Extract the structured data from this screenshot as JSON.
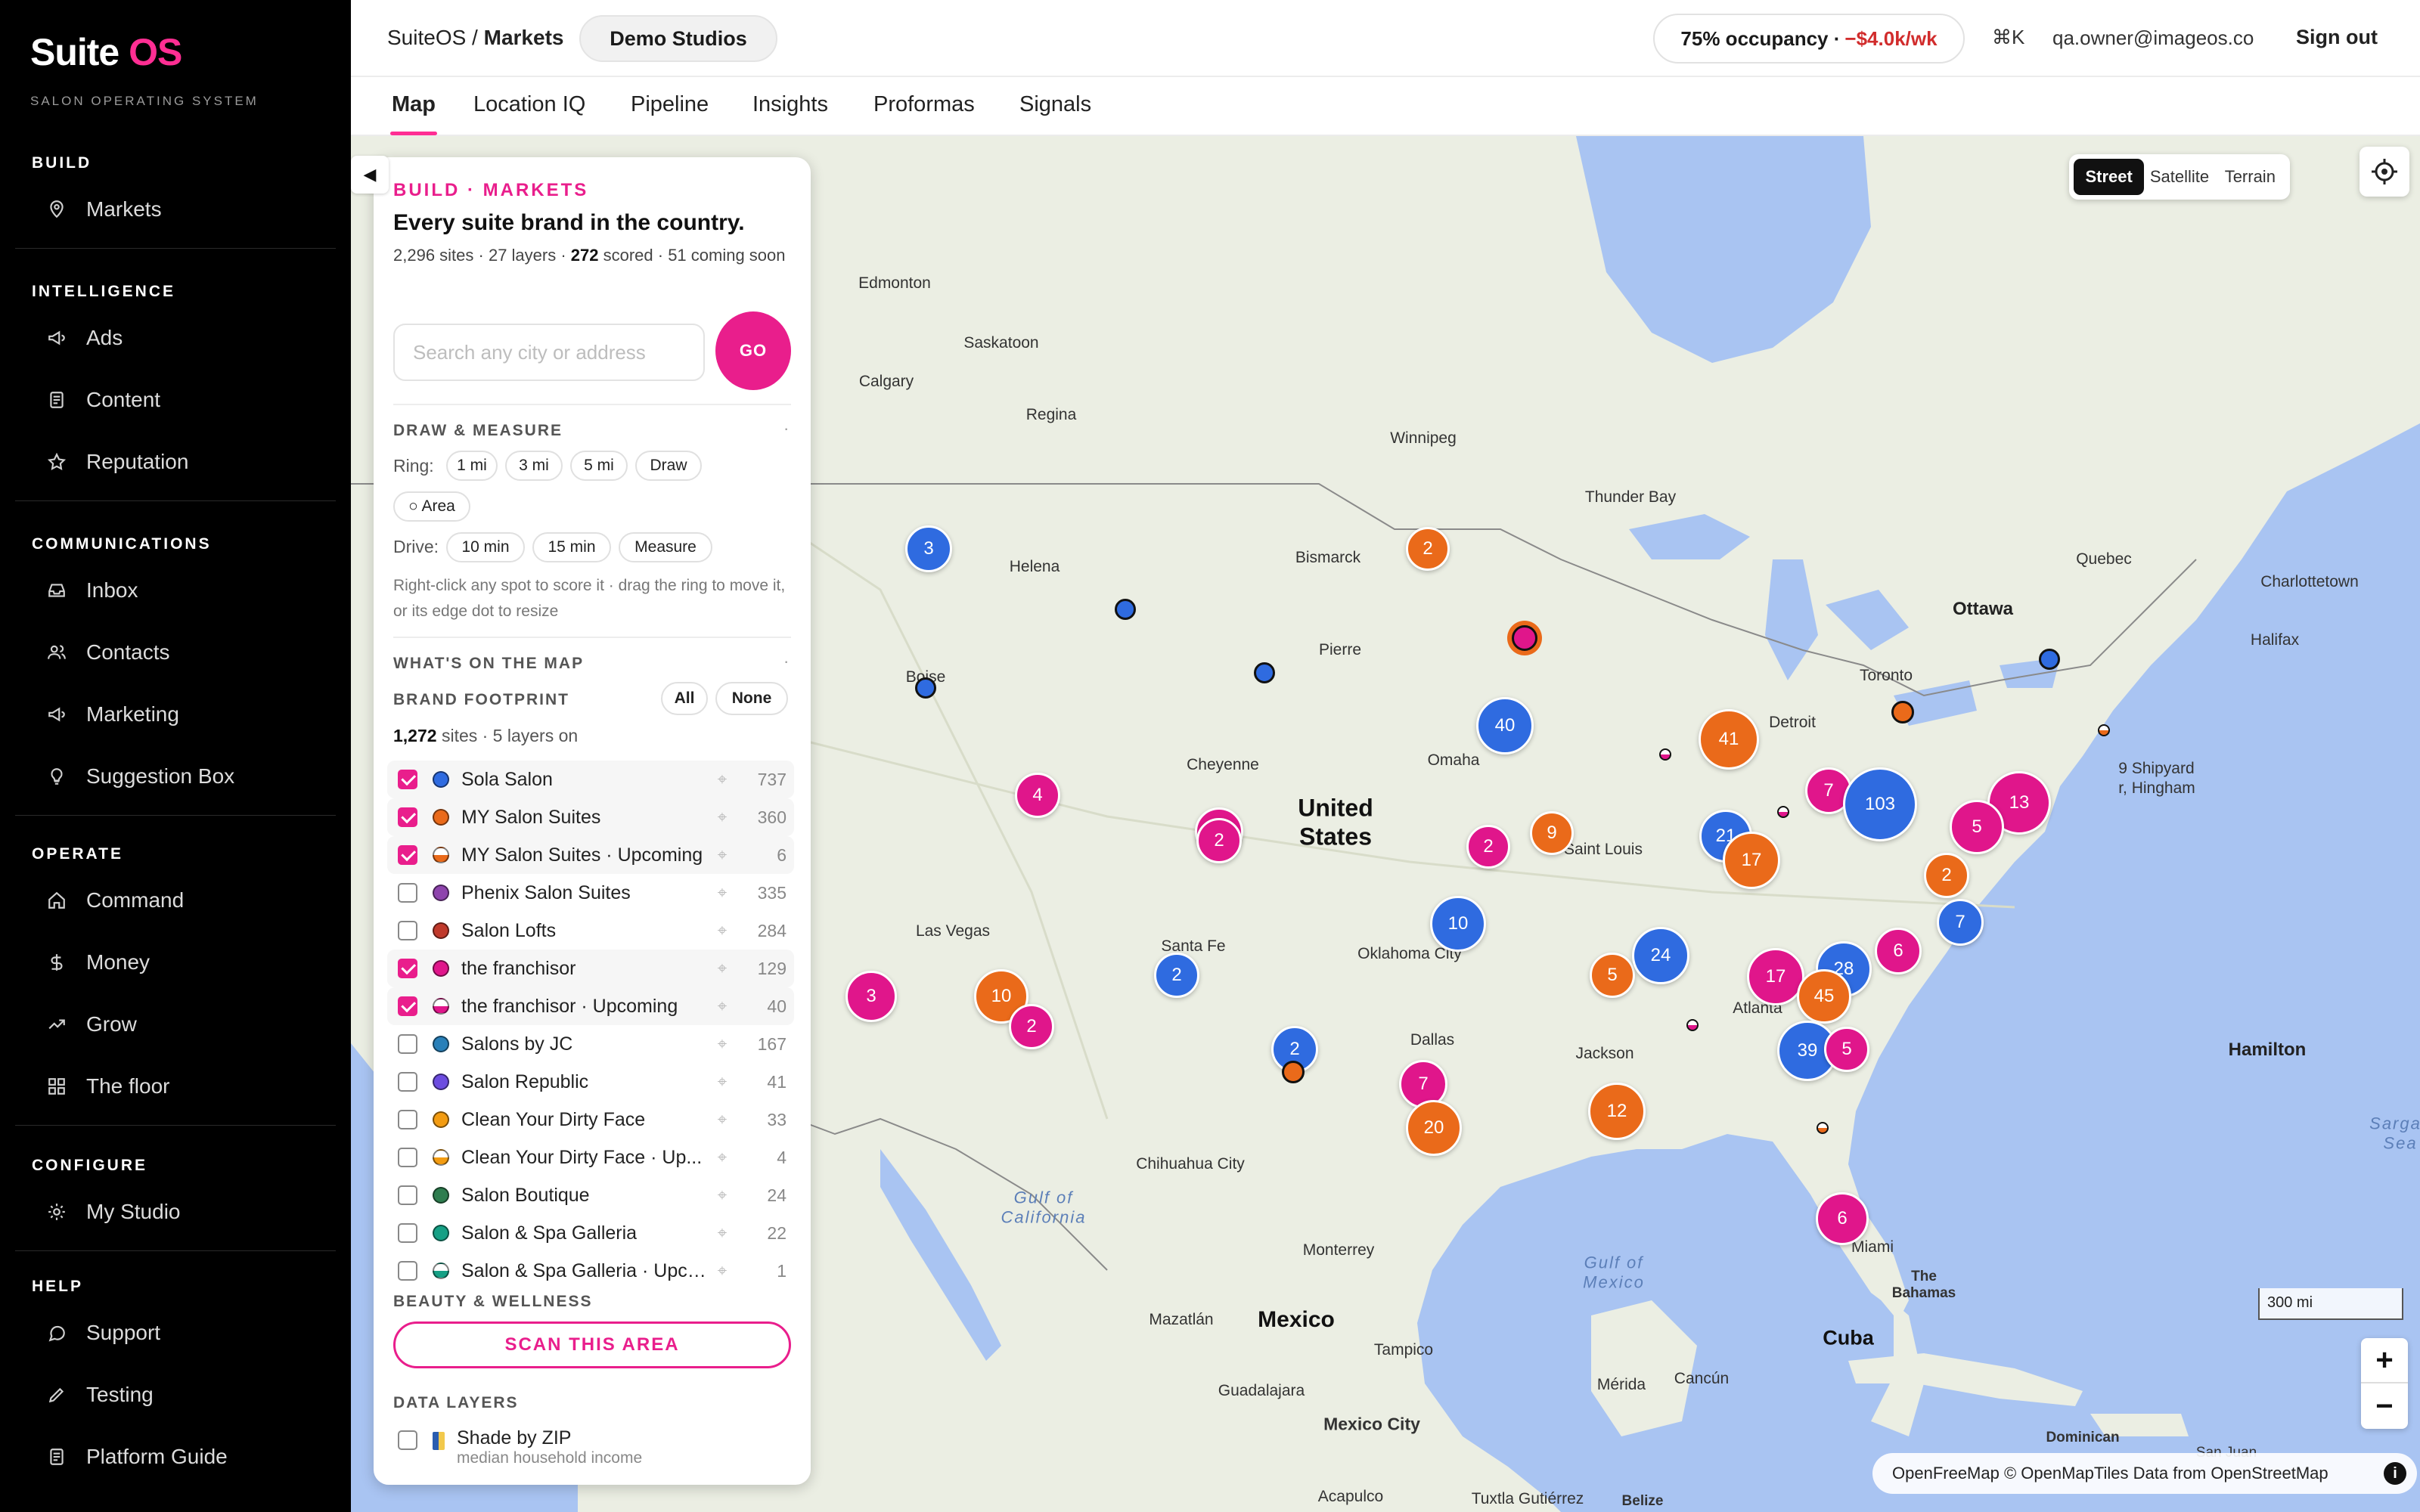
{
  "brand": {
    "name_a": "Suite",
    "name_b": "OS",
    "tagline": "SALON OPERATING SYSTEM"
  },
  "sidebar": {
    "sections": [
      {
        "heading": "BUILD",
        "items": [
          {
            "label": "Markets",
            "icon": "pin-icon"
          }
        ]
      },
      {
        "heading": "INTELLIGENCE",
        "items": [
          {
            "label": "Ads",
            "icon": "megaphone-icon"
          },
          {
            "label": "Content",
            "icon": "document-icon"
          },
          {
            "label": "Reputation",
            "icon": "star-icon"
          }
        ]
      },
      {
        "heading": "COMMUNICATIONS",
        "items": [
          {
            "label": "Inbox",
            "icon": "inbox-icon"
          },
          {
            "label": "Contacts",
            "icon": "users-icon"
          },
          {
            "label": "Marketing",
            "icon": "megaphone-icon"
          },
          {
            "label": "Suggestion Box",
            "icon": "lightbulb-icon"
          }
        ]
      },
      {
        "heading": "OPERATE",
        "items": [
          {
            "label": "Command",
            "icon": "home-icon"
          },
          {
            "label": "Money",
            "icon": "dollar-icon"
          },
          {
            "label": "Grow",
            "icon": "trend-icon"
          },
          {
            "label": "The floor",
            "icon": "grid-icon"
          }
        ]
      },
      {
        "heading": "CONFIGURE",
        "items": [
          {
            "label": "My Studio",
            "icon": "gear-icon"
          }
        ]
      },
      {
        "heading": "HELP",
        "items": [
          {
            "label": "Support",
            "icon": "chat-icon"
          },
          {
            "label": "Testing",
            "icon": "pencil-icon"
          },
          {
            "label": "Platform Guide",
            "icon": "document-icon"
          }
        ]
      }
    ]
  },
  "topbar": {
    "crumb_root": "SuiteOS /",
    "crumb_page": "Markets",
    "studio": "Demo Studios",
    "occupancy": "75% occupancy ·",
    "occupancy_delta": "−$4.0k/wk",
    "shortcut": "⌘K",
    "email": "qa.owner@imageos.co",
    "signout": "Sign out"
  },
  "tabs": [
    "Map",
    "Location IQ",
    "Pipeline",
    "Insights",
    "Proformas",
    "Signals"
  ],
  "map": {
    "styles": [
      "Street",
      "Satellite",
      "Terrain"
    ],
    "active_style": "Street",
    "scale": "300 mi",
    "attribution": "OpenFreeMap © OpenMapTiles Data from OpenStreetMap",
    "zoom_in": "+",
    "zoom_out": "−",
    "labels": {
      "edmonton": "Edmonton",
      "saskatoon": "Saskatoon",
      "calgary": "Calgary",
      "regina": "Regina",
      "winnipeg": "Winnipeg",
      "thunder_bay": "Thunder Bay",
      "quebec": "Quebec",
      "charlottetown": "Charlottetown",
      "ottawa": "Ottawa",
      "halifax": "Halifax",
      "helena": "Helena",
      "bismarck": "Bismarck",
      "pierre": "Pierre",
      "boise": "Boise",
      "toronto": "Toronto",
      "detroit": "Detroit",
      "cheyenne": "Cheyenne",
      "omaha": "Omaha",
      "united_states": "United\nStates",
      "saint_louis": "Saint Louis",
      "shipyard": "9 Shipyard\nr, Hingham",
      "las_vegas": "Las Vegas",
      "santa_fe": "Santa Fe",
      "oklahoma_city": "Oklahoma City",
      "atlanta": "Atlanta",
      "dallas": "Dallas",
      "jackson": "Jackson",
      "chihuahua": "Chihuahua City",
      "gulf_california": "Gulf of\nCalifornia",
      "monterrey": "Monterrey",
      "gulf_mexico": "Gulf of\nMexico",
      "miami": "Miami",
      "bahamas": "The\nBahamas",
      "hamilton": "Hamilton",
      "sargasso": "Sargas\nSea",
      "mazatlan": "Mazatlán",
      "mexico": "Mexico",
      "cuba": "Cuba",
      "tampico": "Tampico",
      "guadalajara": "Guadalajara",
      "merida": "Mérida",
      "cancun": "Cancún",
      "mexico_city": "Mexico City",
      "dominican": "Dominican",
      "san_juan": "San Juan",
      "acapulco": "Acapulco",
      "tuxtla": "Tuxtla Gutiérrez",
      "belize": "Belize"
    },
    "clusters": [
      {
        "label": "3",
        "color": "#2f6be0"
      },
      {
        "label": "2",
        "color": "#ea6a1a"
      },
      {
        "label": "40",
        "color": "#2f6be0"
      },
      {
        "label": "4",
        "color": "#e0168b"
      },
      {
        "label": "2",
        "color": "#e0168b"
      },
      {
        "label": "41",
        "color": "#ea6a1a"
      },
      {
        "label": "7",
        "color": "#e0168b"
      },
      {
        "label": "103",
        "color": "#2f6be0"
      },
      {
        "label": "13",
        "color": "#e0168b"
      },
      {
        "label": "5",
        "color": "#e0168b"
      },
      {
        "label": "2",
        "color": "#e0168b"
      },
      {
        "label": "9",
        "color": "#ea6a1a"
      },
      {
        "label": "21",
        "color": "#2f6be0"
      },
      {
        "label": "17",
        "color": "#ea6a1a"
      },
      {
        "label": "2",
        "color": "#ea6a1a"
      },
      {
        "label": "7",
        "color": "#2f6be0"
      },
      {
        "label": "10",
        "color": "#2f6be0"
      },
      {
        "label": "2",
        "color": "#2f6be0"
      },
      {
        "label": "5",
        "color": "#ea6a1a"
      },
      {
        "label": "24",
        "color": "#2f6be0"
      },
      {
        "label": "17",
        "color": "#e0168b"
      },
      {
        "label": "28",
        "color": "#2f6be0"
      },
      {
        "label": "45",
        "color": "#ea6a1a"
      },
      {
        "label": "6",
        "color": "#e0168b"
      },
      {
        "label": "3",
        "color": "#e0168b"
      },
      {
        "label": "10",
        "color": "#ea6a1a"
      },
      {
        "label": "2",
        "color": "#e0168b"
      },
      {
        "label": "2",
        "color": "#2f6be0"
      },
      {
        "label": "7",
        "color": "#e0168b"
      },
      {
        "label": "20",
        "color": "#ea6a1a"
      },
      {
        "label": "12",
        "color": "#ea6a1a"
      },
      {
        "label": "39",
        "color": "#2f6be0"
      },
      {
        "label": "5",
        "color": "#e0168b"
      },
      {
        "label": "6",
        "color": "#e0168b"
      },
      {
        "label": "3",
        "color": "#e0168b"
      },
      {
        "label": "2",
        "color": "#e0168b"
      }
    ]
  },
  "panel": {
    "kicker": "BUILD · MARKETS",
    "title": "Every suite brand in the country.",
    "sub_a": "2,296 sites · 27 layers · ",
    "sub_b": "272",
    "sub_c": " scored · 51 coming soon",
    "search_placeholder": "Search any city or address",
    "go": "GO",
    "draw_heading": "DRAW & MEASURE",
    "ring_label": "Ring:",
    "ring_chips": [
      "1 mi",
      "3 mi",
      "5 mi",
      "Draw",
      "○ Area"
    ],
    "drive_label": "Drive:",
    "drive_chips": [
      "10 min",
      "15 min",
      "Measure"
    ],
    "hint": "Right-click any spot to score it · drag the ring to move it, or its edge dot to resize",
    "map_heading": "WHAT'S ON THE MAP",
    "footprint_heading": "BRAND FOOTPRINT",
    "all": "All",
    "none": "None",
    "stat_a": "1,272",
    "stat_b": " sites · 5 layers on",
    "layers": [
      {
        "name": "Sola Salon",
        "count": "737",
        "checked": true,
        "color": "#2f6be0",
        "half": false
      },
      {
        "name": "MY Salon Suites",
        "count": "360",
        "checked": true,
        "color": "#ea6a1a",
        "half": false
      },
      {
        "name": "MY Salon Suites · Upcoming",
        "count": "6",
        "checked": true,
        "color": "#ea6a1a",
        "half": true
      },
      {
        "name": "Phenix Salon Suites",
        "count": "335",
        "checked": false,
        "color": "#8e44ad",
        "half": false
      },
      {
        "name": "Salon Lofts",
        "count": "284",
        "checked": false,
        "color": "#c0392b",
        "half": false
      },
      {
        "name": "the franchisor",
        "count": "129",
        "checked": true,
        "color": "#e0168b",
        "half": false
      },
      {
        "name": "the franchisor · Upcoming",
        "count": "40",
        "checked": true,
        "color": "#e0168b",
        "half": true
      },
      {
        "name": "Salons by JC",
        "count": "167",
        "checked": false,
        "color": "#2980b9",
        "half": false
      },
      {
        "name": "Salon Republic",
        "count": "41",
        "checked": false,
        "color": "#6c4ce0",
        "half": false
      },
      {
        "name": "Clean Your Dirty Face",
        "count": "33",
        "checked": false,
        "color": "#f39c12",
        "half": false
      },
      {
        "name": "Clean Your Dirty Face · Up...",
        "count": "4",
        "checked": false,
        "color": "#f39c12",
        "half": true
      },
      {
        "name": "Salon Boutique",
        "count": "24",
        "checked": false,
        "color": "#2e7d4f",
        "half": false
      },
      {
        "name": "Salon & Spa Galleria",
        "count": "22",
        "checked": false,
        "color": "#16a085",
        "half": false
      },
      {
        "name": "Salon & Spa Galleria · Upco...",
        "count": "1",
        "checked": false,
        "color": "#16a085",
        "half": true
      }
    ],
    "beauty_heading": "BEAUTY & WELLNESS",
    "scan": "SCAN THIS AREA",
    "data_heading": "DATA LAYERS",
    "zip_title": "Shade by ZIP",
    "zip_sub": "median household income"
  }
}
